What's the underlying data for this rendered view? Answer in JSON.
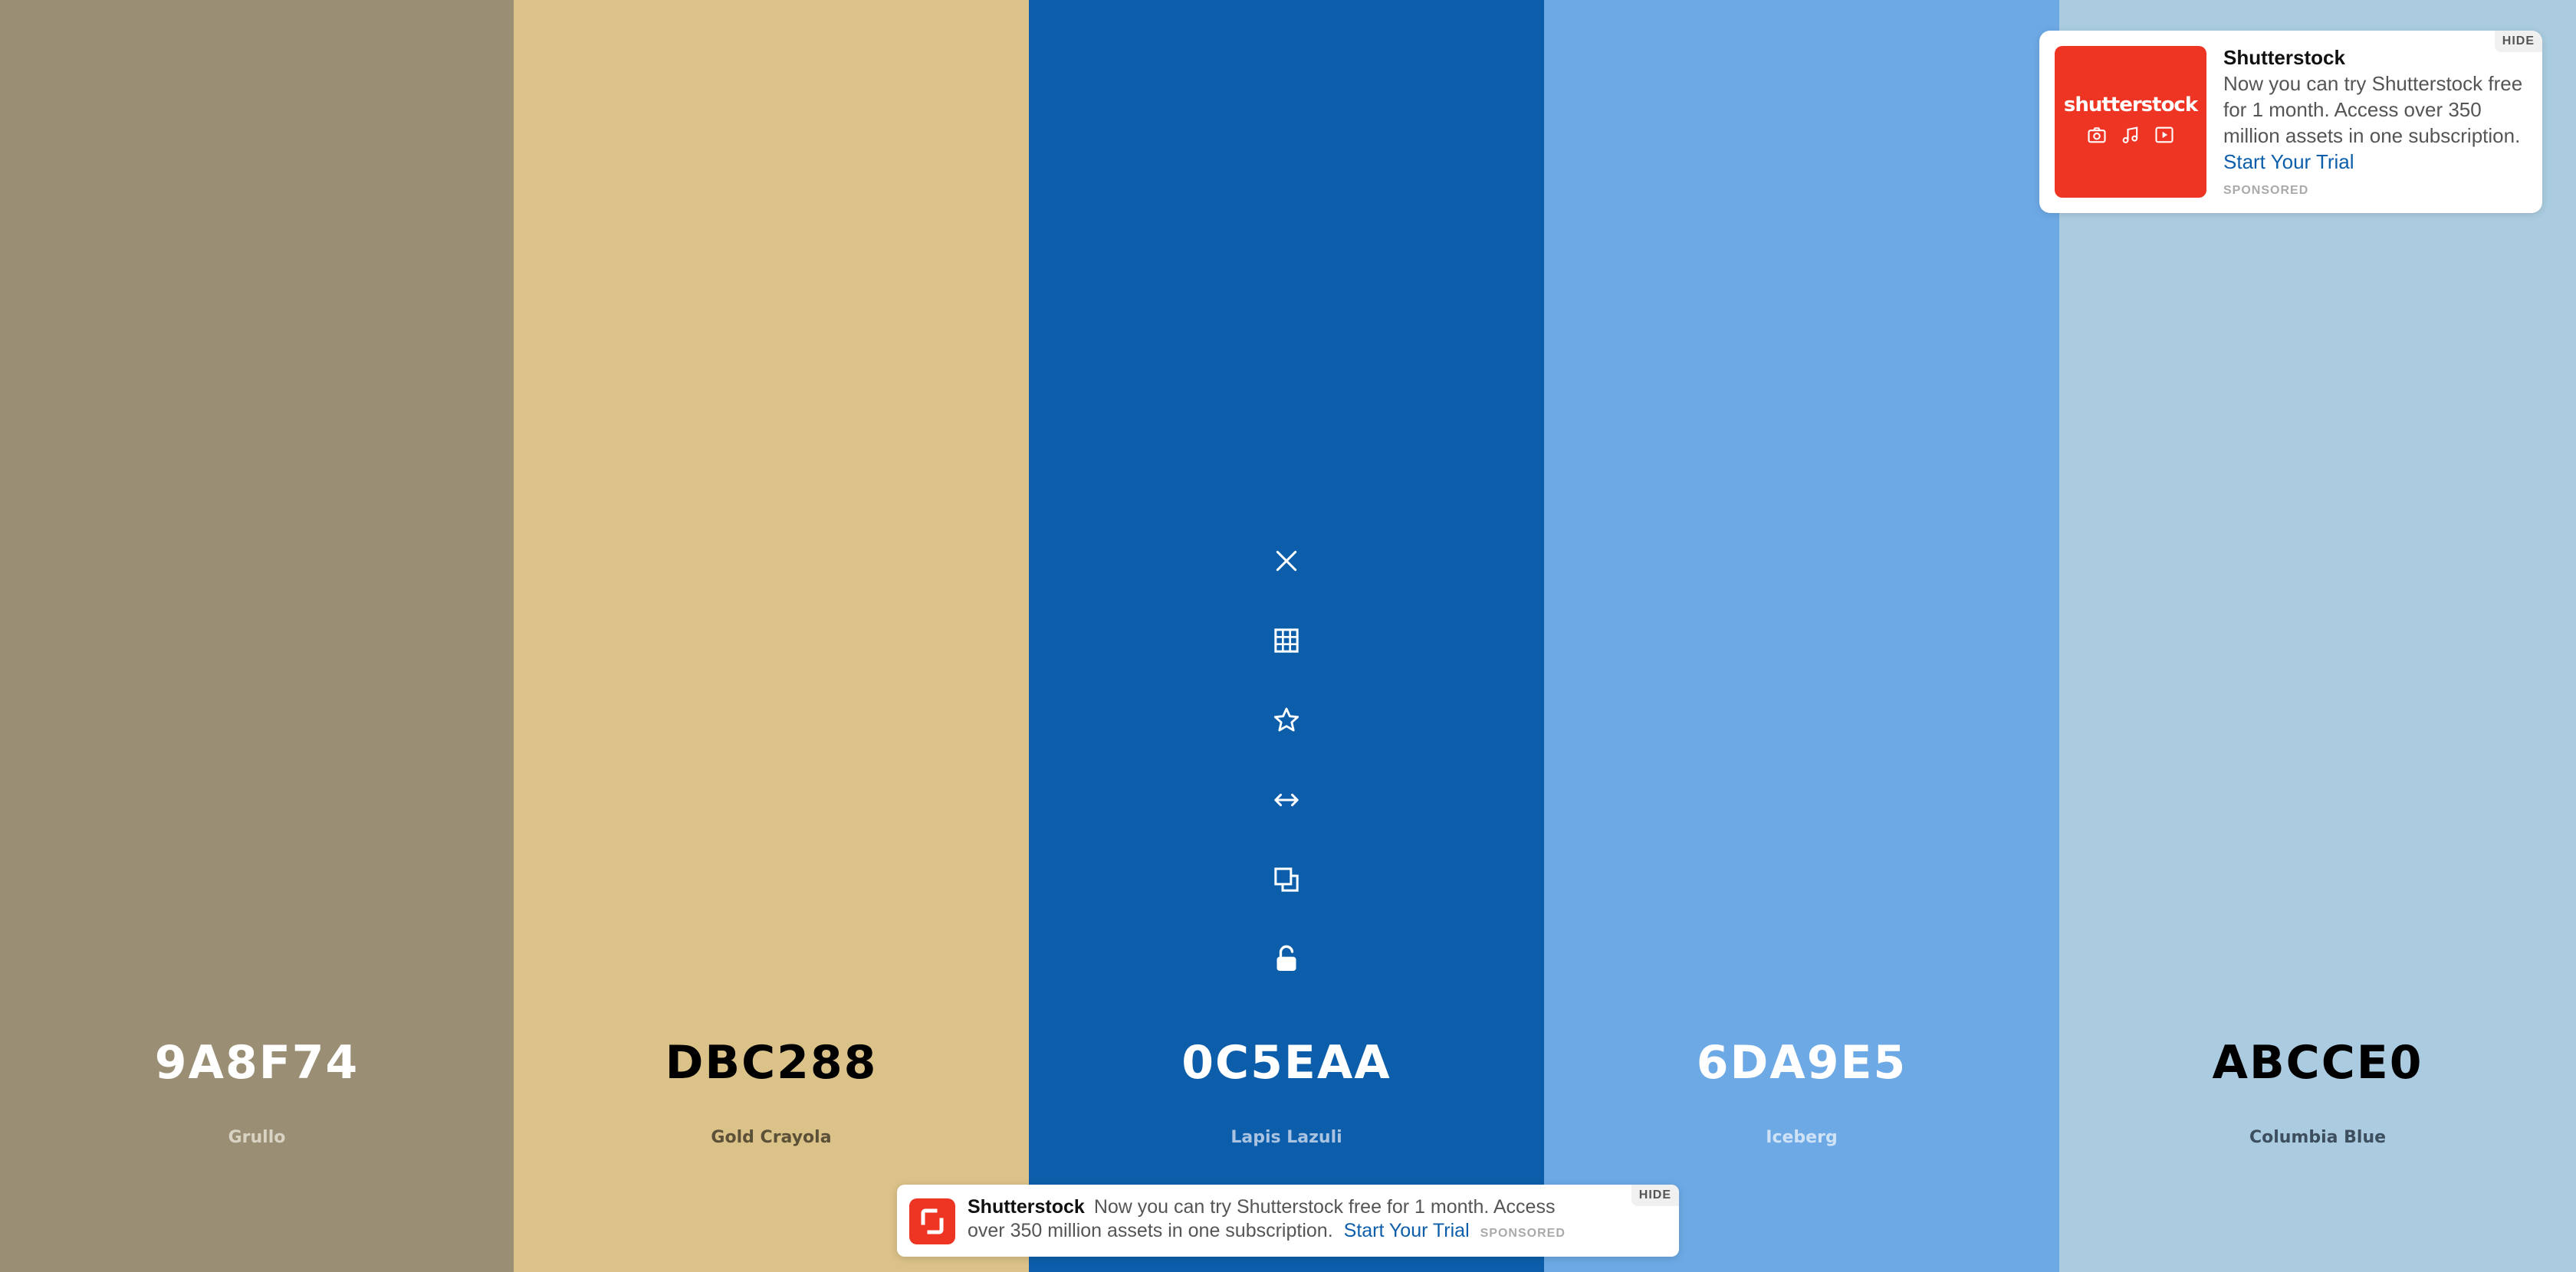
{
  "palette": {
    "colors": [
      {
        "hex": "9A8F74",
        "name": "Grullo",
        "bg": "#9a8f74",
        "hex_color": "#ffffff",
        "name_color": "#d9d3c4"
      },
      {
        "hex": "DBC288",
        "name": "Gold Crayola",
        "bg": "#dbc288",
        "hex_color": "#000000",
        "name_color": "#5c5138"
      },
      {
        "hex": "0C5EAA",
        "name": "Lapis Lazuli",
        "bg": "#0c5eaa",
        "hex_color": "#ffffff",
        "name_color": "#a9c3e0"
      },
      {
        "hex": "6DA9E5",
        "name": "Iceberg",
        "bg": "#6da9e5",
        "hex_color": "#ffffff",
        "name_color": "#cfe2f6"
      },
      {
        "hex": "ABCCE0",
        "name": "Columbia Blue",
        "bg": "#abcce0",
        "hex_color": "#000000",
        "name_color": "#3d4f5e"
      }
    ],
    "active_index": 2,
    "tool_icons": [
      "close-icon",
      "grid-icon",
      "star-icon",
      "arrows-horizontal-icon",
      "copy-icon",
      "unlock-icon"
    ]
  },
  "ad_card": {
    "brand_word": "shutterstock",
    "title": "Shutterstock",
    "text": "Now you can try Shutterstock free for 1 month. Access over 350 million assets in one subscription.",
    "link": "Start Your Trial",
    "sponsored": "SPONSORED",
    "hide": "HIDE"
  },
  "ad_banner": {
    "title": "Shutterstock",
    "text": "Now you can try Shutterstock free for 1 month. Access over 350 million assets in one subscription.",
    "link": "Start Your Trial",
    "sponsored": "SPONSORED",
    "hide": "HIDE"
  },
  "colors": {
    "brand_red": "#ee3524",
    "link_blue": "#0c5eaa"
  }
}
